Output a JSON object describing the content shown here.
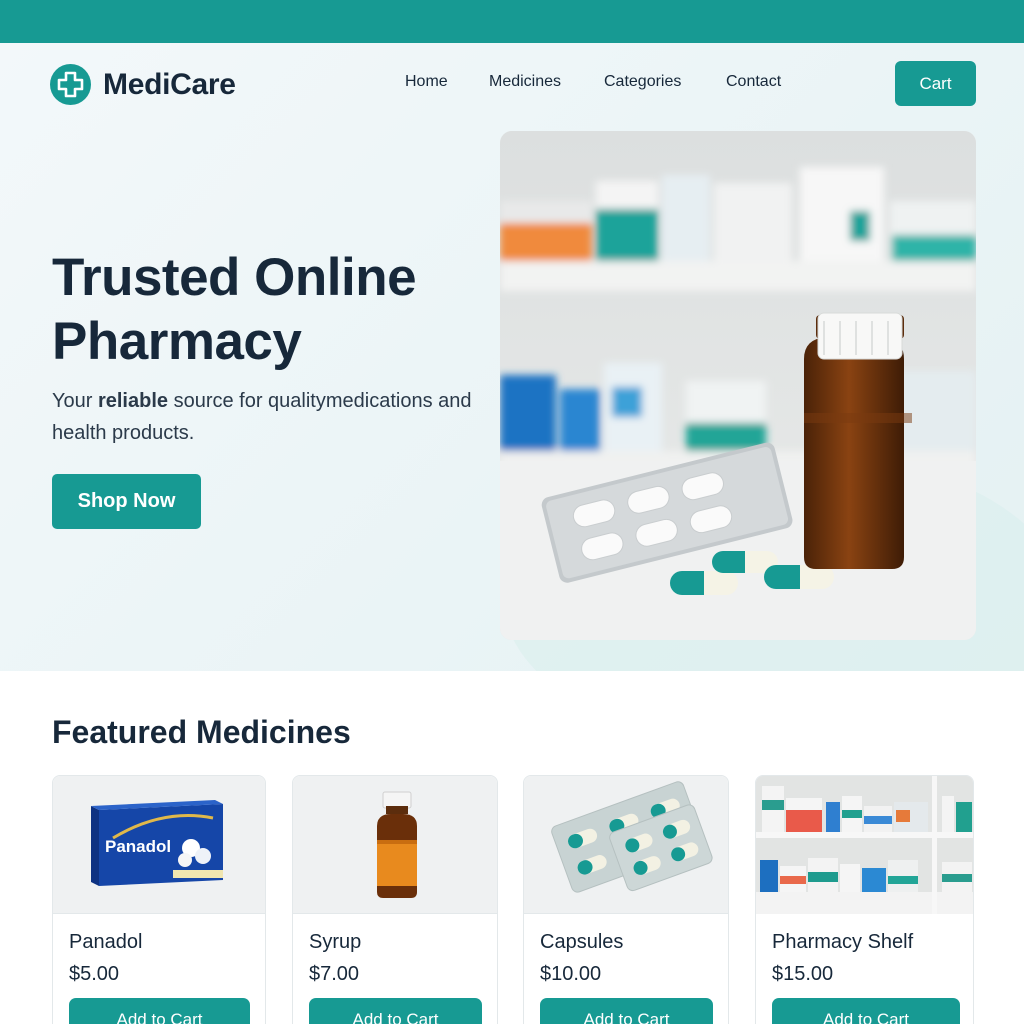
{
  "brand": {
    "name": "MediCare",
    "logo_icon": "medical-cross-icon"
  },
  "nav": {
    "items": [
      "Home",
      "Medicines",
      "Categories",
      "Contact"
    ],
    "cart_label": "Cart"
  },
  "hero": {
    "title": "Trusted Online Pharmacy",
    "subtitle_prefix": "Your ",
    "subtitle_bold": "reliable",
    "subtitle_suffix": " source for qualitymedications and health products.",
    "cta_label": "Shop Now"
  },
  "featured": {
    "title": "Featured Medicines",
    "products": [
      {
        "name": "Panadol",
        "price": "$5.00",
        "button": "Add to Cart",
        "box_label": "Panadol"
      },
      {
        "name": "Syrup",
        "price": "$7.00",
        "button": "Add to Cart"
      },
      {
        "name": "Capsules",
        "price": "$10.00",
        "button": "Add to Cart"
      },
      {
        "name": "Pharmacy Shelf",
        "price": "$15.00",
        "button": "Add to Cart"
      }
    ]
  },
  "colors": {
    "accent": "#179a93",
    "text": "#17283a",
    "hero_bg": "#eef6f8"
  }
}
